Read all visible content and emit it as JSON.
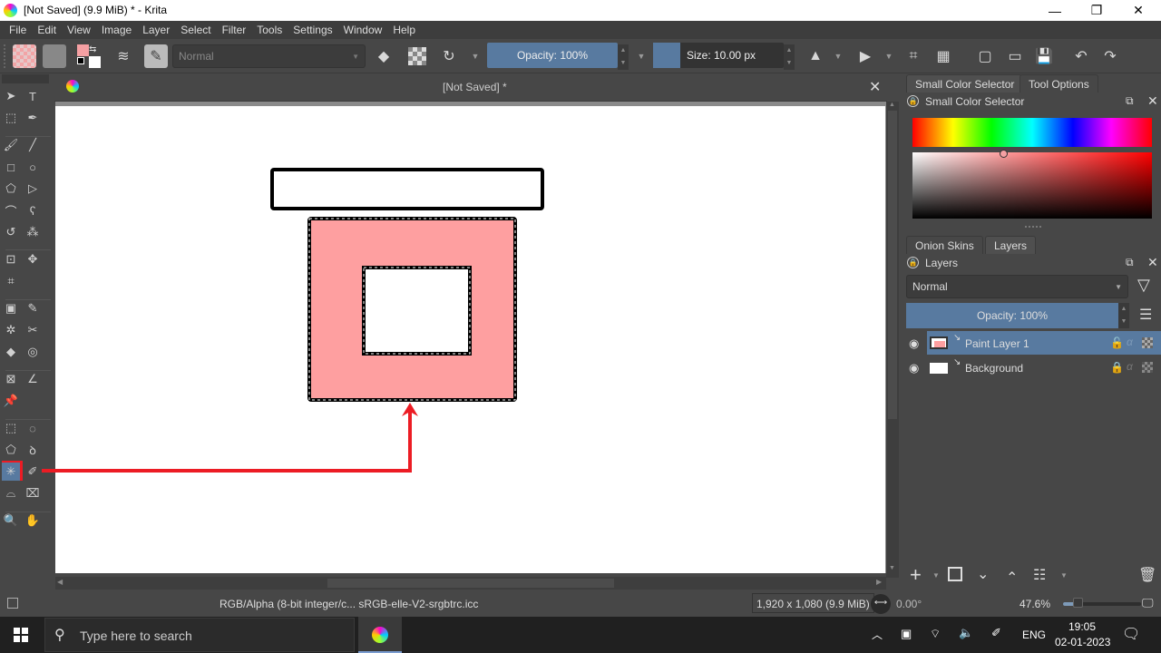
{
  "window": {
    "title": "[Not Saved]  (9.9 MiB)  * - Krita",
    "minimize": "—",
    "maximize": "❐",
    "close": "✕"
  },
  "menu": [
    "File",
    "Edit",
    "View",
    "Image",
    "Layer",
    "Select",
    "Filter",
    "Tools",
    "Settings",
    "Window",
    "Help"
  ],
  "toolbar": {
    "blend_mode": "Normal",
    "opacity_label": "Opacity: 100%",
    "opacity_value": 100,
    "size_label": "Size: 10.00 px",
    "size_value": 10.0,
    "foreground_color": "#f5a0a3",
    "background_color": "#ffffff"
  },
  "toolbox": {
    "tools": [
      {
        "name": "select-shapes-tool",
        "glyph": "➤"
      },
      {
        "name": "text-tool",
        "glyph": "T"
      },
      {
        "name": "edit-shapes-tool",
        "glyph": "⬚"
      },
      {
        "name": "calligraphy-tool",
        "glyph": "✒"
      },
      {
        "name": "freehand-brush-tool",
        "glyph": "🖌"
      },
      {
        "name": "line-tool",
        "glyph": "╱"
      },
      {
        "name": "rectangle-tool",
        "glyph": "□"
      },
      {
        "name": "ellipse-tool",
        "glyph": "○"
      },
      {
        "name": "polygon-tool",
        "glyph": "⬠"
      },
      {
        "name": "polyline-tool",
        "glyph": "▷"
      },
      {
        "name": "bezier-curve-tool",
        "glyph": "⌒"
      },
      {
        "name": "freehand-path-tool",
        "glyph": "ʕ"
      },
      {
        "name": "dynamic-brush-tool",
        "glyph": "↺"
      },
      {
        "name": "multibrush-tool",
        "glyph": "⁂"
      },
      {
        "name": "transform-tool",
        "glyph": "⊡"
      },
      {
        "name": "move-tool",
        "glyph": "✥"
      },
      {
        "name": "crop-tool",
        "glyph": "⌗"
      },
      {
        "name": "gradient-tool",
        "glyph": "▣"
      },
      {
        "name": "color-sampler-tool",
        "glyph": "✎"
      },
      {
        "name": "colorize-mask-tool",
        "glyph": "✲"
      },
      {
        "name": "smart-patch-tool",
        "glyph": "✂"
      },
      {
        "name": "fill-tool",
        "glyph": "◆"
      },
      {
        "name": "enclose-fill-tool",
        "glyph": "◎"
      },
      {
        "name": "assistant-tool",
        "glyph": "⊠"
      },
      {
        "name": "measure-tool",
        "glyph": "∠"
      },
      {
        "name": "reference-images-tool",
        "glyph": "📌"
      },
      {
        "name": "rectangular-selection-tool",
        "glyph": "⬚"
      },
      {
        "name": "elliptical-selection-tool",
        "glyph": "◌"
      },
      {
        "name": "polygonal-selection-tool",
        "glyph": "⬠"
      },
      {
        "name": "freehand-selection-tool",
        "glyph": "ꝺ"
      },
      {
        "name": "contiguous-selection-tool",
        "glyph": "✳"
      },
      {
        "name": "similar-color-selection-tool",
        "glyph": "✐"
      },
      {
        "name": "bezier-selection-tool",
        "glyph": "⌓"
      },
      {
        "name": "magnetic-selection-tool",
        "glyph": "⌧"
      },
      {
        "name": "zoom-tool",
        "glyph": "🔍"
      },
      {
        "name": "pan-tool",
        "glyph": "✋"
      }
    ],
    "active_tool": "contiguous-selection-tool"
  },
  "document": {
    "tab_title": "[Not Saved]  *",
    "close": "✕",
    "fill_color": "#fe9fa0",
    "annotation_color": "#ec1c24"
  },
  "dock": {
    "color_tabs": [
      "Small Color Selector",
      "Tool Options"
    ],
    "color_panel_title": "Small Color Selector",
    "layer_tabs": [
      "Onion Skins",
      "Layers"
    ],
    "layers_panel_title": "Layers",
    "layers_blend_mode": "Normal",
    "layers_opacity_label": "Opacity:  100%",
    "layers": [
      {
        "name": "Paint Layer 1",
        "selected": true,
        "visible": true,
        "locked": false
      },
      {
        "name": "Background",
        "selected": false,
        "visible": true,
        "locked": true
      }
    ]
  },
  "status": {
    "color_model": "RGB/Alpha (8-bit integer/c...  sRGB-elle-V2-srgbtrc.icc",
    "dimensions": "1,920 x 1,080 (9.9 MiB)",
    "rotation": "0.00°",
    "zoom": "47.6%"
  },
  "taskbar": {
    "search_placeholder": "Type here to search",
    "language": "ENG",
    "time": "19:05",
    "date": "02-01-2023"
  }
}
